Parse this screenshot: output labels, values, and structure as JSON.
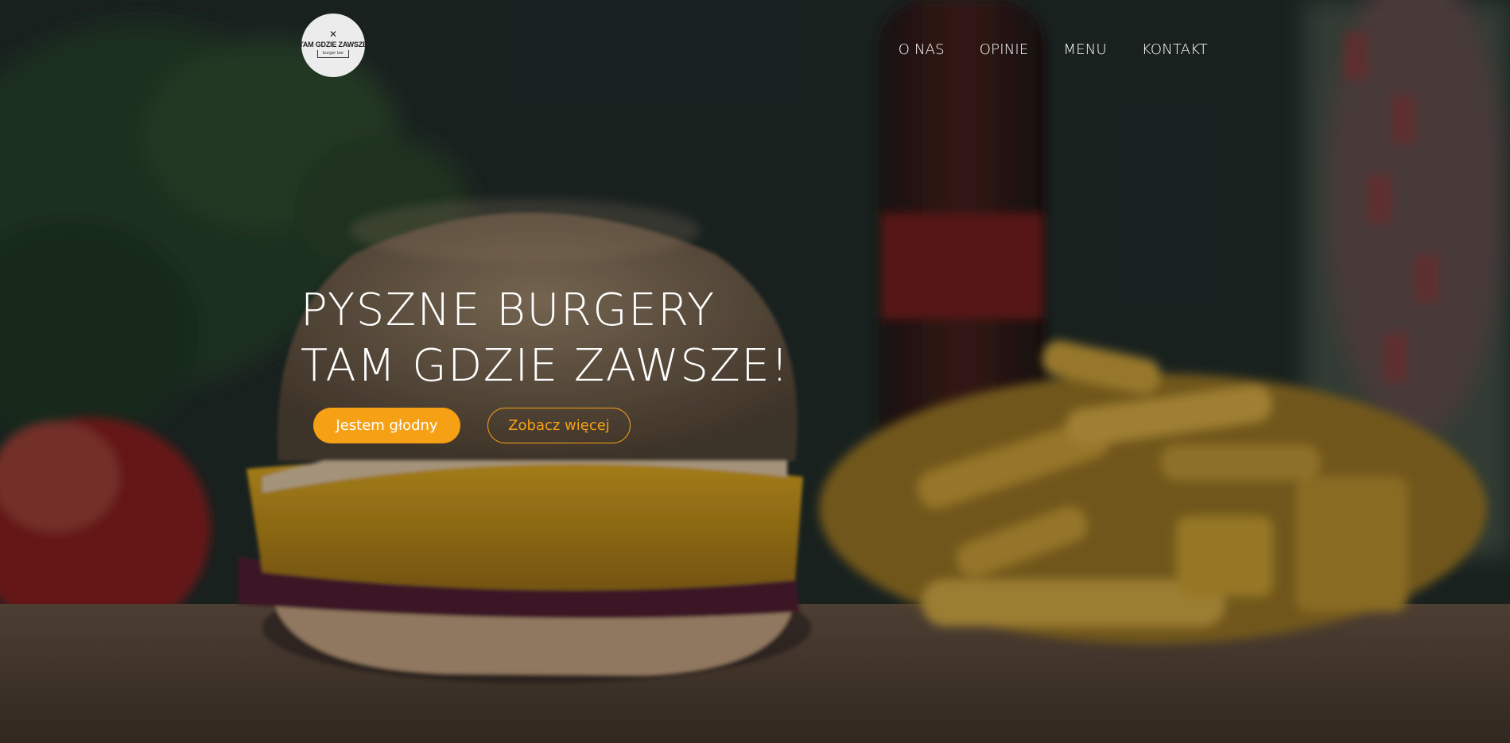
{
  "brand": {
    "logo_name": "TAM GDZIE ZAWSZE",
    "logo_tagline": "burger bar",
    "logo_icon": "crossed-utensils-icon"
  },
  "nav": {
    "items": [
      {
        "label": "O NAS"
      },
      {
        "label": "OPINIE"
      },
      {
        "label": "MENU"
      },
      {
        "label": "KONTAKT"
      }
    ]
  },
  "hero": {
    "headline_line1": "PYSZNE BURGERY",
    "headline_line2": "TAM GDZIE ZAWSZE!",
    "primary_button": "Jestem głodny",
    "secondary_button": "Zobacz więcej",
    "background_image": "burger-with-fries-and-cola-photo"
  },
  "colors": {
    "accent": "#f6a016",
    "text": "#ffffff",
    "logo_bg": "#ececec"
  }
}
